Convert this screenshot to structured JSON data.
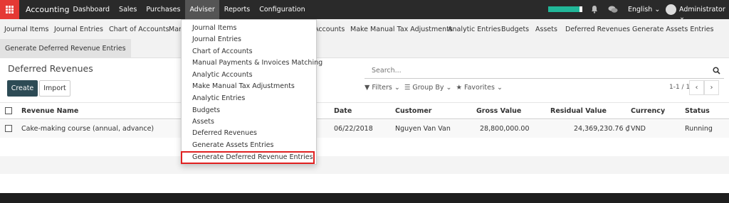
{
  "topbar": {
    "brand": "Accounting",
    "menu": [
      "Dashboard",
      "Sales",
      "Purchases",
      "Adviser",
      "Reports",
      "Configuration"
    ],
    "active_menu": "Adviser",
    "progress_percent": 90,
    "language": "English",
    "user": "Administrator"
  },
  "secondary_menu": {
    "items": [
      "Journal Items",
      "Journal Entries",
      "Chart of Accounts",
      "Mar",
      "Accounts",
      "Make Manual Tax Adjustments",
      "Analytic Entries",
      "Budgets",
      "Assets",
      "Deferred Revenues",
      "Generate Assets Entries"
    ],
    "highlighted": "Generate Deferred Revenue Entries"
  },
  "dropdown": {
    "items": [
      "Journal Items",
      "Journal Entries",
      "Chart of Accounts",
      "Manual Payments & Invoices Matching",
      "Analytic Accounts",
      "Make Manual Tax Adjustments",
      "Analytic Entries",
      "Budgets",
      "Assets",
      "Deferred Revenues",
      "Generate Assets Entries",
      "Generate Deferred Revenue Entries"
    ],
    "selected": "Generate Deferred Revenue Entries"
  },
  "control": {
    "breadcrumb": "Deferred Revenues",
    "create_label": "Create",
    "import_label": "Import",
    "search_placeholder": "Search...",
    "filters_label": "Filters",
    "groupby_label": "Group By",
    "favorites_label": "Favorites",
    "pager": "1-1 / 1"
  },
  "table": {
    "columns": [
      "Revenue Name",
      "Date",
      "Customer",
      "Gross Value",
      "Residual Value",
      "Currency",
      "Status"
    ],
    "rows": [
      {
        "name": "Cake-making course (annual, advance)",
        "date": "06/22/2018",
        "customer": "Nguyen Van Van",
        "gross": "28,800,000.00",
        "residual": "24,369,230.76 ₫",
        "currency": "VND",
        "status": "Running"
      }
    ]
  },
  "colors": {
    "topbar": "#2a2a2a",
    "apps_button": "#e53935",
    "progress": "#21b799",
    "primary_button": "#2d4b55",
    "highlight_border": "#e02020"
  }
}
